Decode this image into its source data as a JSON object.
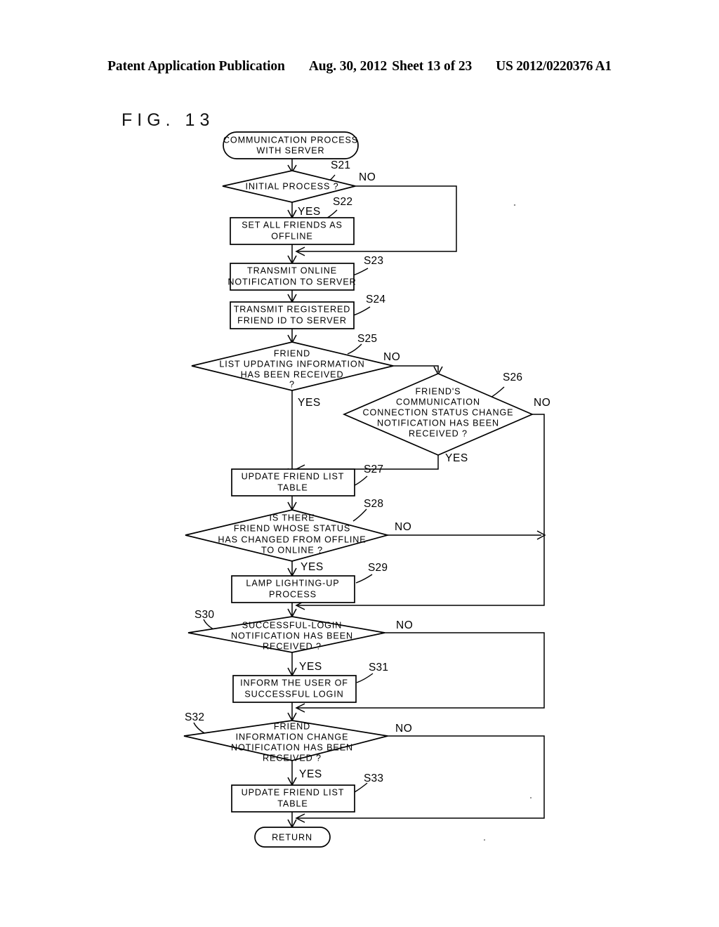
{
  "header": {
    "title": "Patent Application Publication",
    "date": "Aug. 30, 2012",
    "sheet": "Sheet 13 of 23",
    "publication_number": "US 2012/0220376 A1"
  },
  "figure": {
    "label": "FIG. 13"
  },
  "flowchart": {
    "start": {
      "id": "start",
      "text_lines": [
        "COMMUNICATION PROCESS",
        "WITH SERVER"
      ]
    },
    "end": {
      "id": "return",
      "text_lines": [
        "RETURN"
      ]
    },
    "nodes": [
      {
        "id": "s21",
        "step": "S21",
        "type": "decision",
        "text_lines": [
          "INITIAL PROCESS ?"
        ]
      },
      {
        "id": "s22",
        "step": "S22",
        "type": "process",
        "text_lines": [
          "SET ALL FRIENDS AS",
          "OFFLINE"
        ]
      },
      {
        "id": "s23",
        "step": "S23",
        "type": "process",
        "text_lines": [
          "TRANSMIT ONLINE",
          "NOTIFICATION TO SERVER"
        ]
      },
      {
        "id": "s24",
        "step": "S24",
        "type": "process",
        "text_lines": [
          "TRANSMIT REGISTERED",
          "FRIEND ID TO SERVER"
        ]
      },
      {
        "id": "s25",
        "step": "S25",
        "type": "decision",
        "text_lines": [
          "FRIEND",
          "LIST UPDATING INFORMATION",
          "HAS BEEN RECEIVED",
          "?"
        ]
      },
      {
        "id": "s26",
        "step": "S26",
        "type": "decision",
        "text_lines": [
          "FRIEND'S",
          "COMMUNICATION",
          "CONNECTION STATUS CHANGE",
          "NOTIFICATION HAS BEEN",
          "RECEIVED ?"
        ]
      },
      {
        "id": "s27",
        "step": "S27",
        "type": "process",
        "text_lines": [
          "UPDATE FRIEND LIST",
          "TABLE"
        ]
      },
      {
        "id": "s28",
        "step": "S28",
        "type": "decision",
        "text_lines": [
          "IS THERE",
          "FRIEND WHOSE STATUS",
          "HAS CHANGED FROM OFFLINE",
          "TO ONLINE ?"
        ]
      },
      {
        "id": "s29",
        "step": "S29",
        "type": "process",
        "text_lines": [
          "LAMP LIGHTING-UP",
          "PROCESS"
        ]
      },
      {
        "id": "s30",
        "step": "S30",
        "type": "decision",
        "text_lines": [
          "SUCCESSFUL-LOGIN",
          "NOTIFICATION HAS BEEN",
          "RECEIVED ?"
        ]
      },
      {
        "id": "s31",
        "step": "S31",
        "type": "process",
        "text_lines": [
          "INFORM THE USER OF",
          "SUCCESSFUL LOGIN"
        ]
      },
      {
        "id": "s32",
        "step": "S32",
        "type": "decision",
        "text_lines": [
          "FRIEND",
          "INFORMATION CHANGE",
          "NOTIFICATION HAS BEEN",
          "RECEIVED ?"
        ]
      },
      {
        "id": "s33",
        "step": "S33",
        "type": "process",
        "text_lines": [
          "UPDATE FRIEND LIST",
          "TABLE"
        ]
      }
    ],
    "branch_labels": {
      "yes": "YES",
      "no": "NO"
    },
    "branches": [
      {
        "from": "s21",
        "label": "NO",
        "to": "s23"
      },
      {
        "from": "s21",
        "label": "YES",
        "to": "s22"
      },
      {
        "from": "s25",
        "label": "NO",
        "to": "s26"
      },
      {
        "from": "s25",
        "label": "YES",
        "to": "s27"
      },
      {
        "from": "s26",
        "label": "YES",
        "to": "s27"
      },
      {
        "from": "s26",
        "label": "NO",
        "to": "s30"
      },
      {
        "from": "s28",
        "label": "YES",
        "to": "s29"
      },
      {
        "from": "s28",
        "label": "NO",
        "to": "s30"
      },
      {
        "from": "s30",
        "label": "YES",
        "to": "s31"
      },
      {
        "from": "s30",
        "label": "NO",
        "to": "s32"
      },
      {
        "from": "s32",
        "label": "YES",
        "to": "s33"
      },
      {
        "from": "s32",
        "label": "NO",
        "to": "return"
      }
    ]
  },
  "colors": {
    "ink": "#000000",
    "paper": "#ffffff"
  }
}
